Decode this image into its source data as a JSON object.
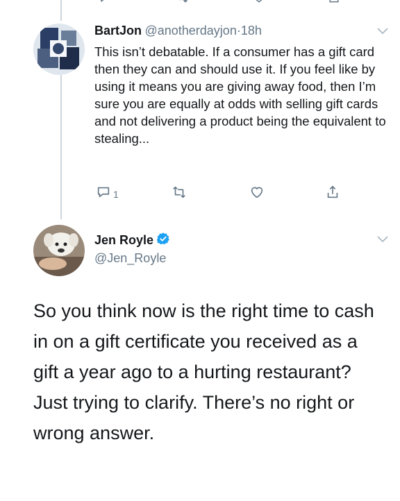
{
  "reply": {
    "display_name": "BartJon",
    "handle": "@anotherdayjon",
    "separator": "·",
    "time": "18h",
    "text": "This isn’t debatable. If a consumer has a gift card then they can and should use it. If you feel like by using it means you are giving away food, then I’m sure you are equally at odds with selling gift cards and not delivering a product being the equivalent to stealing...",
    "reply_count": "1",
    "icons": [
      "reply-icon",
      "retweet-icon",
      "like-icon",
      "share-icon",
      "chevron-down-icon"
    ]
  },
  "main_tweet": {
    "display_name": "Jen Royle",
    "handle": "@Jen_Royle",
    "verified": true,
    "text": "So you think now is the right time to cash in on a gift certificate you received as a gift a year ago to a hurting restaurant? Just trying to clarify. There’s no right or wrong answer."
  },
  "colors": {
    "text": "#14171a",
    "secondary": "#657786",
    "verified_blue": "#1da1f2",
    "thread_line": "#ccd6dd"
  }
}
